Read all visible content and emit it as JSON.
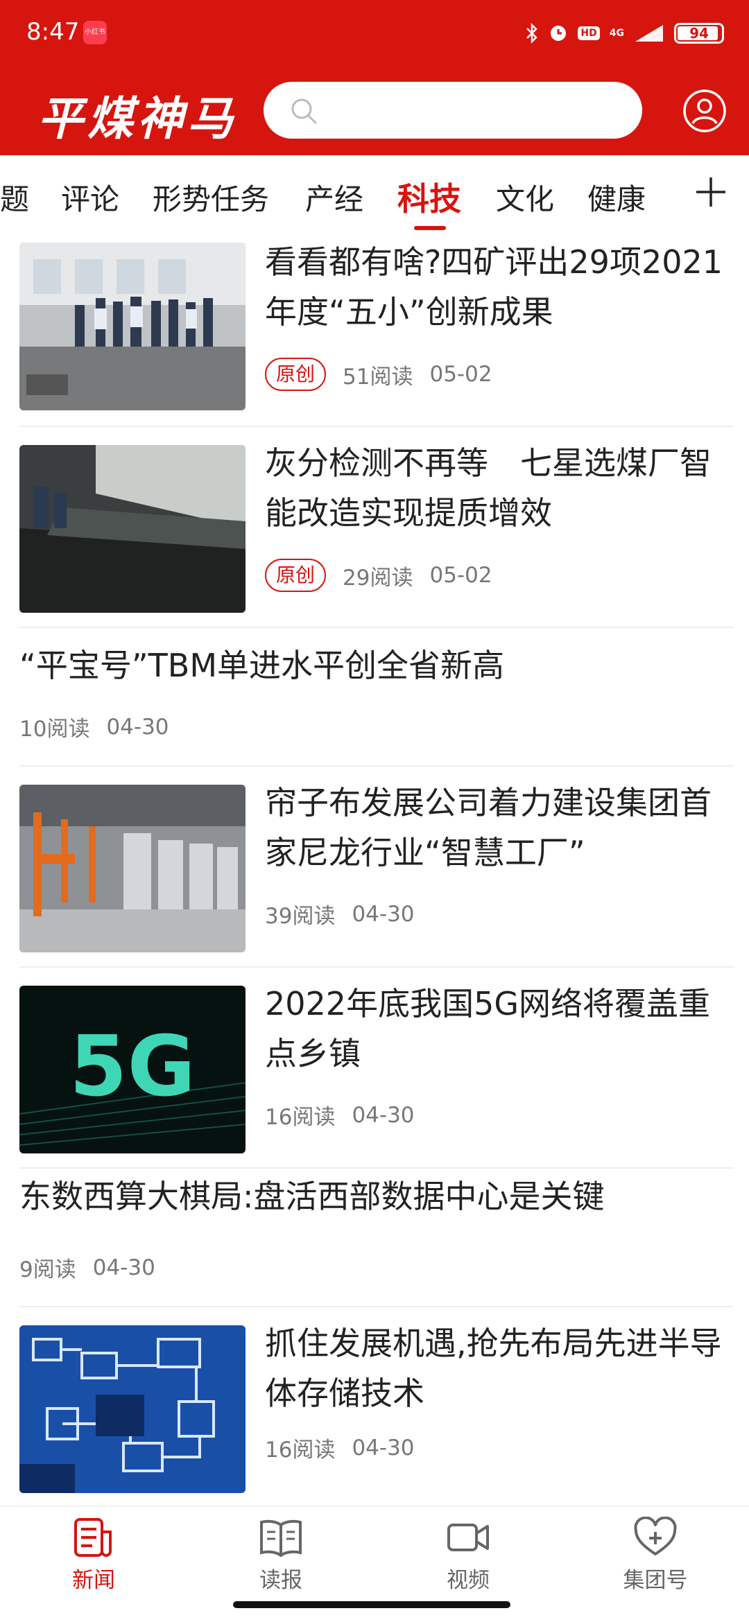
{
  "status_bar": {
    "time": "8:47",
    "app_badge": "小红书",
    "hd": "HD",
    "network": "4G",
    "battery": "94",
    "battery_level": 0.94
  },
  "header": {
    "logo": "平煤神马",
    "search_placeholder": ""
  },
  "tabs": {
    "items": [
      {
        "label": "题"
      },
      {
        "label": "评论"
      },
      {
        "label": "形势任务"
      },
      {
        "label": "产经"
      },
      {
        "label": "科技"
      },
      {
        "label": "文化"
      },
      {
        "label": "健康"
      }
    ],
    "active": "科技",
    "add_symbol": "十"
  },
  "feed": {
    "articles": [
      {
        "title": "看看都有啥?四矿评出29项2021年度“五小”创新成果",
        "tag": "原创",
        "reads": "51阅读",
        "date": "05-02",
        "thumb": "workshop-photo"
      },
      {
        "title": "灰分检测不再等　七星选煤厂智能改造实现提质增效",
        "tag": "原创",
        "reads": "29阅读",
        "date": "05-02",
        "thumb": "conveyor-photo"
      },
      {
        "title": "“平宝号”TBM单进水平创全省新高",
        "reads": "10阅读",
        "date": "04-30"
      },
      {
        "title": "帘子布发展公司着力建设集团首家尼龙行业“智慧工厂”",
        "reads": "39阅读",
        "date": "04-30",
        "thumb": "factory-photo"
      },
      {
        "title": "2022年底我国5G网络将覆盖重点乡镇",
        "reads": "16阅读",
        "date": "04-30",
        "thumb": "5g-image",
        "thumb_text": "5G"
      },
      {
        "title": "东数西算大棋局:盘活西部数据中心是关键",
        "reads": "9阅读",
        "date": "04-30"
      },
      {
        "title": "抓住发展机遇,抢先布局先进半导体存储技术",
        "reads": "16阅读",
        "date": "04-30",
        "thumb": "circuit-image"
      }
    ]
  },
  "bottom_nav": {
    "items": [
      {
        "label": "新闻",
        "icon": "news-icon"
      },
      {
        "label": "读报",
        "icon": "book-icon"
      },
      {
        "label": "视频",
        "icon": "video-icon"
      },
      {
        "label": "集团号",
        "icon": "heart-plus-icon"
      }
    ],
    "active": "新闻"
  },
  "colors": {
    "brand_red": "#d6150f",
    "text": "#222222",
    "meta": "#777777"
  }
}
